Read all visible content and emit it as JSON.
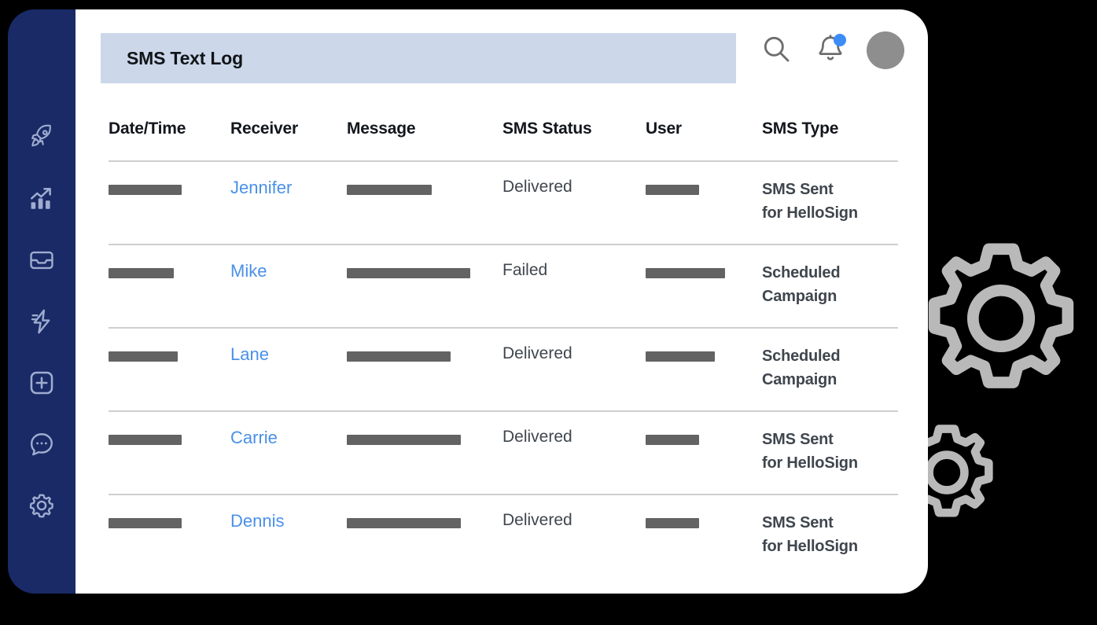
{
  "colors": {
    "sidebar_bg": "#192a66",
    "card_bg": "#ffffff",
    "title_band_bg": "#ccd8ea",
    "receiver_link": "#4a90e8",
    "badge_dot": "#3b8df5",
    "redaction_bar": "#636363",
    "avatar": "#8e8e8e",
    "gear_outline": "#b9b9b9",
    "page_bg": "#000000"
  },
  "sidebar": {
    "items": [
      {
        "icon": "rocket-icon",
        "name": "sidebar-item-rocket"
      },
      {
        "icon": "growth-chart-icon",
        "name": "sidebar-item-analytics"
      },
      {
        "icon": "inbox-icon",
        "name": "sidebar-item-inbox"
      },
      {
        "icon": "lightning-bolt-icon",
        "name": "sidebar-item-automations"
      },
      {
        "icon": "plus-square-icon",
        "name": "sidebar-item-add"
      },
      {
        "icon": "chat-bubble-icon",
        "name": "sidebar-item-messages"
      },
      {
        "icon": "gear-icon",
        "name": "sidebar-item-settings"
      }
    ]
  },
  "header": {
    "title": "SMS Text Log",
    "actions": [
      {
        "icon": "search-icon",
        "name": "search-button"
      },
      {
        "icon": "bell-icon",
        "name": "notifications-button",
        "has_badge": true
      },
      {
        "icon": "avatar",
        "name": "user-avatar"
      }
    ]
  },
  "table": {
    "columns": [
      "Date/Time",
      "Receiver",
      "Message",
      "SMS Status",
      "User",
      "SMS Type"
    ],
    "rows": [
      {
        "datetime": "[redacted]",
        "datetime_bar_width": 93,
        "receiver": "Jennifer",
        "message": "[redacted]",
        "message_bar_width": 108,
        "status": "Delivered",
        "user": "[redacted]",
        "user_bar_width": 68,
        "sms_type_line1": "SMS Sent",
        "sms_type_line2": "for HelloSign"
      },
      {
        "datetime": "[redacted]",
        "datetime_bar_width": 83,
        "receiver": "Mike",
        "message": "[redacted]",
        "message_bar_width": 157,
        "status": "Failed",
        "user": "[redacted]",
        "user_bar_width": 101,
        "sms_type_line1": "Scheduled",
        "sms_type_line2": "Campaign"
      },
      {
        "datetime": "[redacted]",
        "datetime_bar_width": 88,
        "receiver": "Lane",
        "message": "[redacted]",
        "message_bar_width": 132,
        "status": "Delivered",
        "user": "[redacted]",
        "user_bar_width": 88,
        "sms_type_line1": "Scheduled",
        "sms_type_line2": "Campaign"
      },
      {
        "datetime": "[redacted]",
        "datetime_bar_width": 93,
        "receiver": "Carrie",
        "message": "[redacted]",
        "message_bar_width": 145,
        "status": "Delivered",
        "user": "[redacted]",
        "user_bar_width": 68,
        "sms_type_line1": "SMS Sent",
        "sms_type_line2": "for HelloSign"
      },
      {
        "datetime": "[redacted]",
        "datetime_bar_width": 93,
        "receiver": "Dennis",
        "message": "[redacted]",
        "message_bar_width": 145,
        "status": "Delivered",
        "user": "[redacted]",
        "user_bar_width": 68,
        "sms_type_line1": "SMS Sent",
        "sms_type_line2": "for HelloSign"
      }
    ]
  },
  "decorations": {
    "gears": [
      {
        "name": "large-gear-decoration",
        "size": 200
      },
      {
        "name": "small-gear-decoration",
        "size": 122
      }
    ]
  }
}
